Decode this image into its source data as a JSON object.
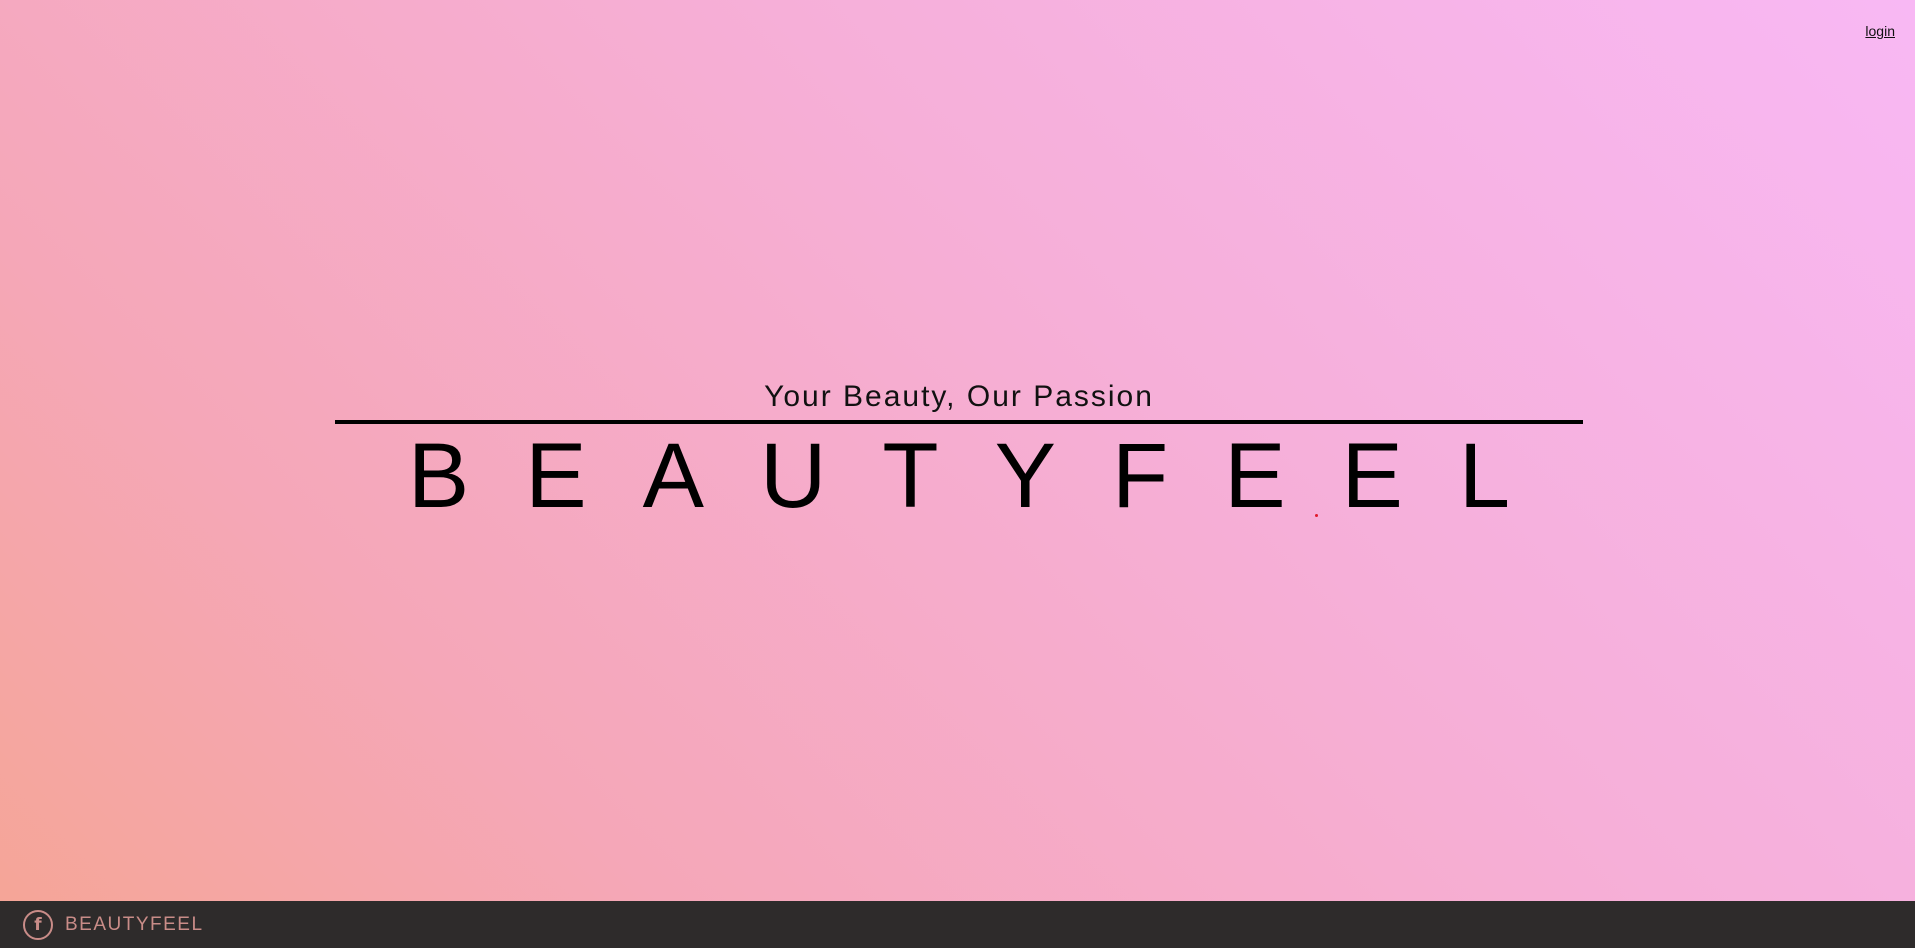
{
  "header": {
    "login_label": "login"
  },
  "hero": {
    "tagline": "Your Beauty, Our Passion",
    "brand": "BEAUTYFEEL"
  },
  "footer": {
    "facebook_icon": "f",
    "brand": "BEAUTYFEEL"
  },
  "colors": {
    "background_start": "#f8b8f4",
    "background_end": "#f5a595",
    "footer_bg": "#2e2b2b",
    "footer_text": "#c98c88",
    "text": "#000000"
  },
  "icons": {
    "facebook": "facebook-icon"
  }
}
